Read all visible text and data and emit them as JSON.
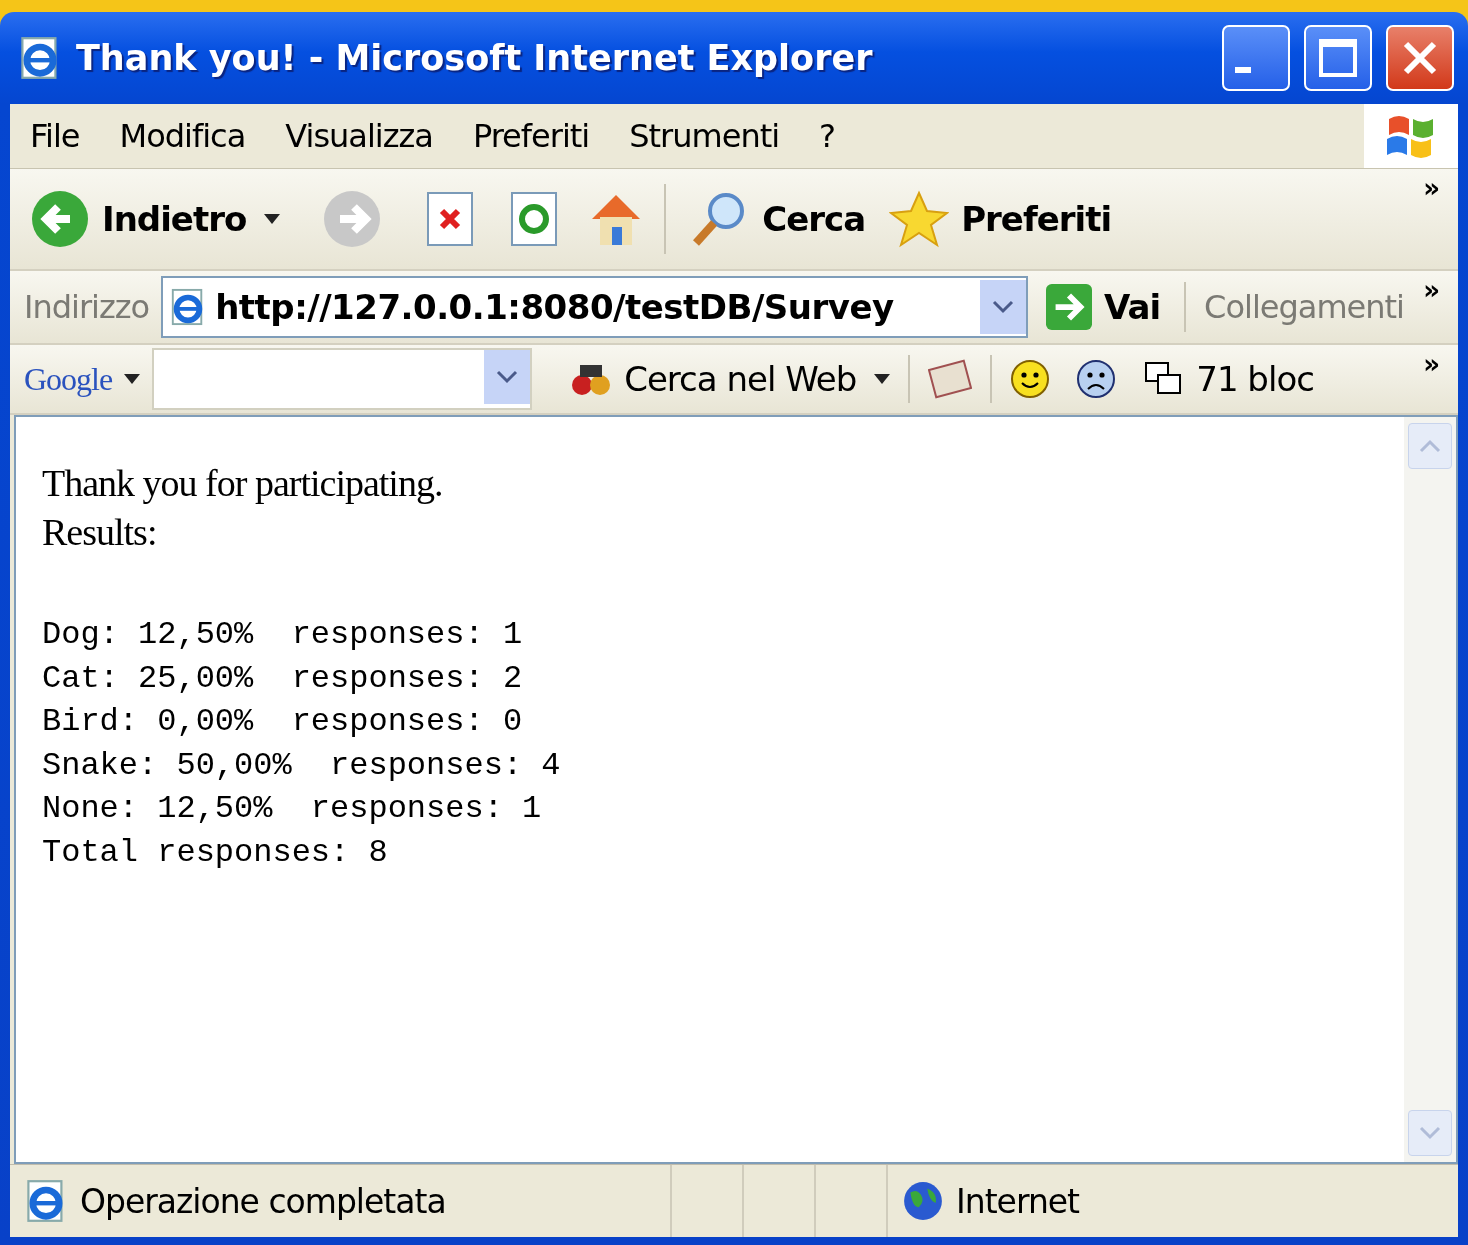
{
  "window": {
    "title": "Thank you! - Microsoft Internet Explorer"
  },
  "menu": [
    "File",
    "Modifica",
    "Visualizza",
    "Preferiti",
    "Strumenti",
    "?"
  ],
  "toolbar": {
    "back": "Indietro",
    "search": "Cerca",
    "favorites": "Preferiti",
    "overflow": "»"
  },
  "address_bar": {
    "label": "Indirizzo",
    "url": "http://127.0.0.1:8080/testDB/Survey",
    "go": "Vai",
    "links": "Collegamenti",
    "overflow": "»"
  },
  "google_bar": {
    "logo": "Google",
    "search_web": "Cerca nel Web",
    "blocked": "71 bloc",
    "overflow": "»"
  },
  "page": {
    "lines": [
      "Thank you for participating.",
      "Results:"
    ],
    "results": [
      "Dog: 12,50%  responses: 1",
      "Cat: 25,00%  responses: 2",
      "Bird: 0,00%  responses: 0",
      "Snake: 50,00%  responses: 4",
      "None: 12,50%  responses: 1",
      "Total responses: 8"
    ]
  },
  "status_bar": {
    "message": "Operazione completata",
    "zone": "Internet"
  }
}
